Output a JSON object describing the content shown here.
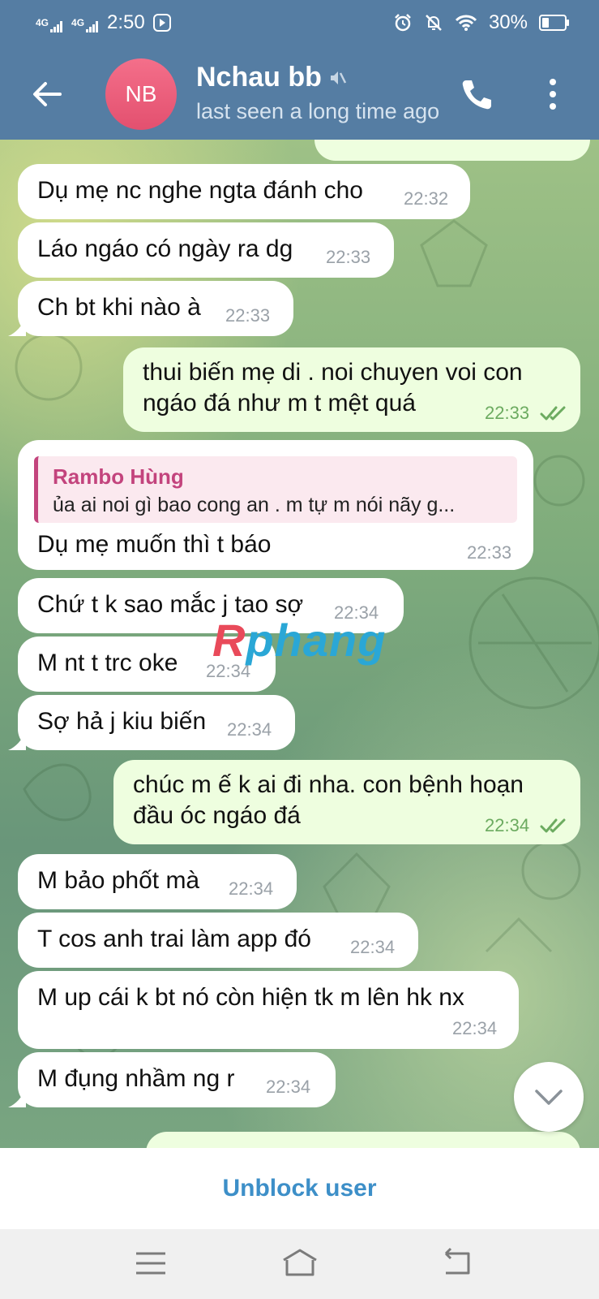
{
  "status_bar": {
    "signal1": "4G",
    "signal2": "4G",
    "time": "2:50",
    "battery": "30%",
    "battery_level": 0.3
  },
  "header": {
    "avatar_initials": "NB",
    "contact_name": "Nchau bb",
    "last_seen": "last seen a long time ago"
  },
  "messages": [
    {
      "text": "Dụ mẹ nc nghe ngta đánh cho",
      "time": "22:32",
      "dir": "in"
    },
    {
      "text": "Láo ngáo có ngày ra dg",
      "time": "22:33",
      "dir": "in"
    },
    {
      "text": "Ch bt khi nào à",
      "time": "22:33",
      "dir": "in"
    },
    {
      "line1": "thui biến mẹ di . noi chuyen voi con",
      "line2": "ngáo đá như m t mệt quá",
      "time": "22:33",
      "dir": "out"
    },
    {
      "reply_name": "Rambo Hùng",
      "reply_text": "ủa ai noi gì bao cong an . m tự m nói nãy g...",
      "text": "Dụ mẹ muốn thì t báo",
      "time": "22:33",
      "dir": "in"
    },
    {
      "text": "Chứ t k sao mắc j tao sợ",
      "time": "22:34",
      "dir": "in"
    },
    {
      "text": "M nt t trc oke",
      "time": "22:34",
      "dir": "in"
    },
    {
      "text": "Sợ hả j kiu biến",
      "time": "22:34",
      "dir": "in"
    },
    {
      "line1": "chúc m ế k ai đi nha. con bệnh hoạn",
      "line2": "đầu óc ngáo đá",
      "time": "22:34",
      "dir": "out"
    },
    {
      "text": "M bảo phốt mà",
      "time": "22:34",
      "dir": "in"
    },
    {
      "text": "T cos anh trai làm app đó",
      "time": "22:34",
      "dir": "in"
    },
    {
      "text": "M up cái k bt nó còn hiện tk m lên hk nx",
      "time": "22:34",
      "dir": "in"
    },
    {
      "text": "M đụng nhầm ng r",
      "time": "22:34",
      "dir": "in"
    }
  ],
  "watermark": {
    "part1": "R",
    "part2": "phang"
  },
  "bottom_bar": {
    "unblock_label": "Unblock user"
  },
  "colors": {
    "header_bg": "#557da3",
    "outgoing_bubble": "#eefedf",
    "incoming_bubble": "#ffffff",
    "accent_link": "#3d8fc8",
    "reply_accent": "#c3447d"
  },
  "icons": [
    "back-arrow-icon",
    "mute-icon",
    "phone-icon",
    "more-vert-icon",
    "double-check-icon",
    "chevron-down-icon",
    "menu-icon",
    "home-icon",
    "back-icon",
    "alarm-icon",
    "dnd-icon",
    "wifi-icon",
    "battery-icon"
  ]
}
